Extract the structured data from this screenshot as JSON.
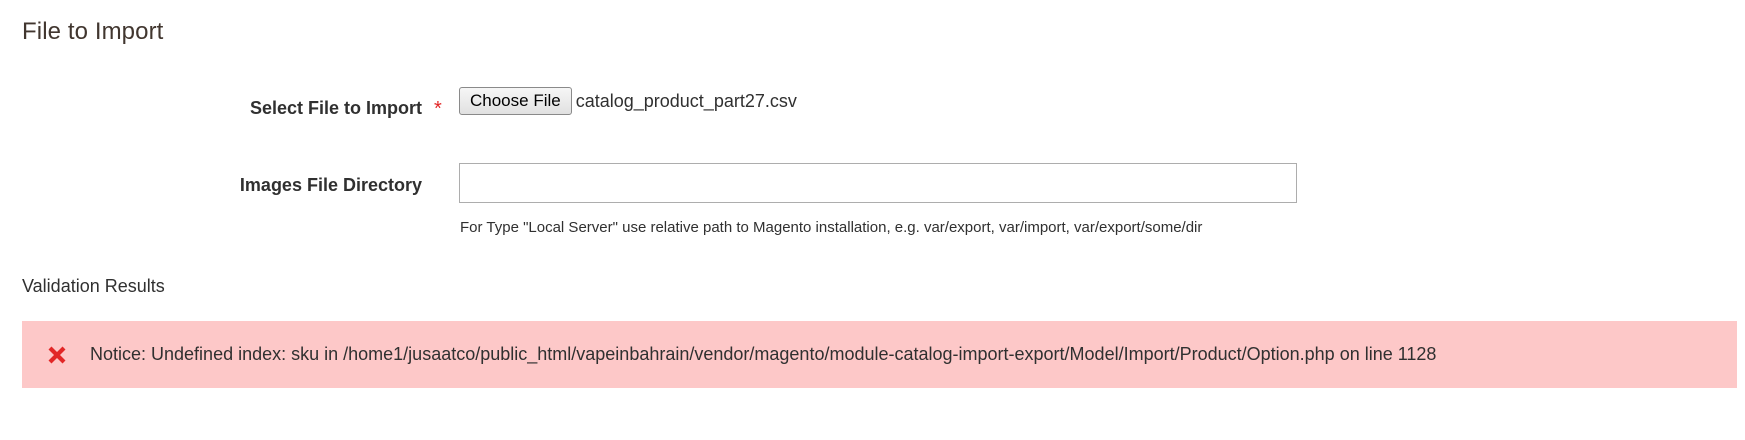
{
  "section": {
    "title": "File to Import"
  },
  "file_field": {
    "label": "Select File to Import",
    "required_marker": "*",
    "button_label": "Choose File",
    "file_name": "catalog_product_part27.csv"
  },
  "images_field": {
    "label": "Images File Directory",
    "value": "",
    "note": "For Type \"Local Server\" use relative path to Magento installation, e.g. var/export, var/import, var/export/some/dir"
  },
  "validation": {
    "title": "Validation Results",
    "error_icon": "close-icon",
    "error_color": "#e22626",
    "background_color": "#fdc8c8",
    "message": "Notice: Undefined index: sku in /home1/jusaatco/public_html/vapeinbahrain/vendor/magento/module-catalog-import-export/Model/Import/Product/Option.php on line 1128"
  }
}
